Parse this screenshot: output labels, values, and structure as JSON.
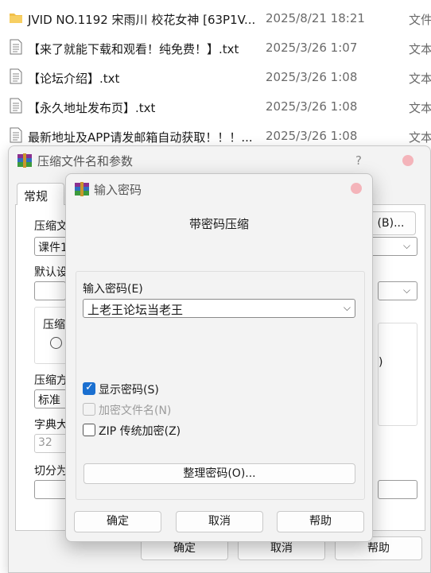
{
  "file_list": [
    {
      "icon": "folder-icon",
      "name": "JVID NO.1192 宋雨川 校花女神 [63P1V...",
      "date": "2025/8/21 18:21",
      "type": "文件"
    },
    {
      "icon": "text-file-icon",
      "name": "【来了就能下载和观看！纯免费！】.txt",
      "date": "2025/3/26 1:07",
      "type": "文本"
    },
    {
      "icon": "text-file-icon",
      "name": "【论坛介绍】.txt",
      "date": "2025/3/26 1:08",
      "type": "文本"
    },
    {
      "icon": "text-file-icon",
      "name": "【永久地址发布页】.txt",
      "date": "2025/3/26 1:08",
      "type": "文本"
    },
    {
      "icon": "text-file-icon",
      "name": "最新地址及APP请发邮箱自动获取！！！...",
      "date": "2025/3/26 1:08",
      "type": "文本"
    }
  ],
  "archive_dialog": {
    "title": "压缩文件名和参数",
    "help": "?",
    "tab_general": "常规",
    "archive_name_label": "压缩文",
    "archive_name_value": "课件1",
    "browse_button": "(B)...",
    "default_label": "默认设",
    "format_group_label": "压缩",
    "method_label": "压缩方",
    "method_value": "标准",
    "dict_label": "字典大",
    "dict_value": "32",
    "split_label": "切分为",
    "right_paren": ")",
    "ok_button": "确定",
    "cancel_button": "取消",
    "help_button": "帮助"
  },
  "password_dialog": {
    "title": "输入密码",
    "heading": "带密码压缩",
    "password_label": "输入密码(E)",
    "password_value": "上老王论坛当老王",
    "show_password": {
      "label": "显示密码(S)",
      "checked": true
    },
    "encrypt_names": {
      "label": "加密文件名(N)",
      "checked": false,
      "disabled": true
    },
    "zip_legacy": {
      "label": "ZIP 传统加密(Z)",
      "checked": false
    },
    "organize_button": "整理密码(O)...",
    "ok_button": "确定",
    "cancel_button": "取消",
    "help_button": "帮助"
  },
  "colors": {
    "accent": "#1a6fd0",
    "close_button": "#f4b4ba",
    "dialog_bg": "#f3f3f3"
  }
}
